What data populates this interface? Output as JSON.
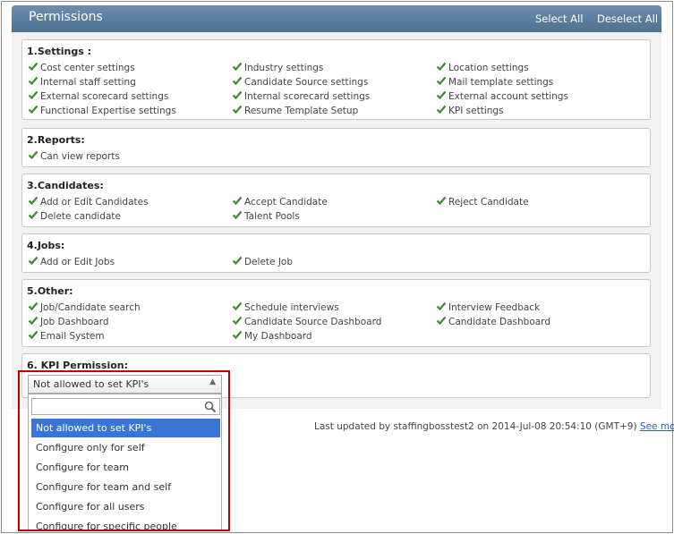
{
  "header": {
    "title": "Permissions",
    "select_all": "Select All",
    "deselect_all": "Deselect All"
  },
  "sections": [
    {
      "title": "1.Settings :",
      "items": [
        {
          "label": "Cost center settings",
          "checked": true
        },
        {
          "label": "Industry settings",
          "checked": true
        },
        {
          "label": "Location settings",
          "checked": true
        },
        {
          "label": "Internal staff setting",
          "checked": true
        },
        {
          "label": "Candidate Source settings",
          "checked": true
        },
        {
          "label": "Mail template settings",
          "checked": true
        },
        {
          "label": "External scorecard settings",
          "checked": true
        },
        {
          "label": "Internal scorecard settings",
          "checked": true
        },
        {
          "label": "External account settings",
          "checked": true
        },
        {
          "label": "Functional Expertise settings",
          "checked": true
        },
        {
          "label": "Resume Template Setup",
          "checked": true
        },
        {
          "label": "KPI settings",
          "checked": true
        }
      ]
    },
    {
      "title": "2.Reports:",
      "items": [
        {
          "label": "Can view reports",
          "checked": true
        }
      ]
    },
    {
      "title": "3.Candidates:",
      "items": [
        {
          "label": "Add or Edit Candidates",
          "checked": true
        },
        {
          "label": "Accept Candidate",
          "checked": true
        },
        {
          "label": "Reject Candidate",
          "checked": true
        },
        {
          "label": "Delete candidate",
          "checked": true
        },
        {
          "label": "Talent Pools",
          "checked": true
        }
      ]
    },
    {
      "title": "4.Jobs:",
      "items": [
        {
          "label": "Add or Edit Jobs",
          "checked": true
        },
        {
          "label": "Delete Job",
          "checked": true
        }
      ]
    },
    {
      "title": "5.Other:",
      "items": [
        {
          "label": "Job/Candidate search",
          "checked": true
        },
        {
          "label": "Schedule interviews",
          "checked": true
        },
        {
          "label": "Interview Feedback",
          "checked": true
        },
        {
          "label": "Job Dashboard",
          "checked": true
        },
        {
          "label": "Candidate Source Dashboard",
          "checked": true
        },
        {
          "label": "Candidate Dashboard",
          "checked": true
        },
        {
          "label": "Email System",
          "checked": true
        },
        {
          "label": "My Dashboard",
          "checked": true
        }
      ]
    },
    {
      "title": "6. KPI Permission:",
      "items": []
    }
  ],
  "kpi_select": {
    "value": "Not allowed to set KPI's",
    "search_placeholder": "",
    "options": [
      "Not allowed to set KPI's",
      "Configure only for self",
      "Configure for team",
      "Configure for team and self",
      "Configure for all users",
      "Configure for specific people"
    ],
    "selected_index": 0
  },
  "footer": {
    "last_updated": "Last updated by staffingbosstest2 on 2014-Jul-08 20:54:10 (GMT+9)",
    "see_more": "See more"
  },
  "colors": {
    "header": "#5a7d9c",
    "check": "#3c8a2e",
    "selected_option": "#3875d7",
    "highlight": "#c00000"
  }
}
